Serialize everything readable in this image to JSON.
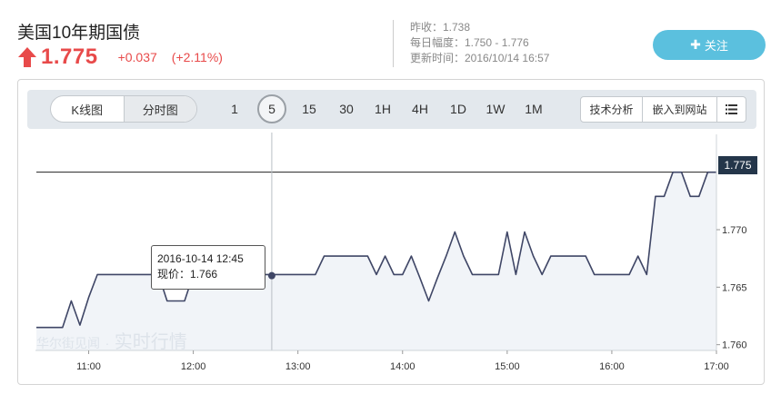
{
  "header": {
    "title": "美国10年期国债",
    "price": "1.775",
    "change": "+0.037",
    "change_pct": "(+2.11%)",
    "prev_close": "昨收：1.738",
    "day_range": "每日幅度：1.750 - 1.776",
    "updated": "更新时间：2016/10/14 16:57",
    "follow_label": "关注",
    "follow_icon": "plus-icon",
    "up_arrow_icon": "arrow-up-icon"
  },
  "toolbar": {
    "view_tabs": [
      "K线图",
      "分时图"
    ],
    "active_view": "分时图",
    "periods": [
      "1",
      "5",
      "15",
      "30",
      "1H",
      "4H",
      "1D",
      "1W",
      "1M"
    ],
    "active_period": "5",
    "tools": [
      "技术分析",
      "嵌入到网站"
    ],
    "menu_icon": "list-icon"
  },
  "watermark": {
    "brand": "华尔街见闻",
    "sep": "·",
    "tagline": "实时行情"
  },
  "tooltip": {
    "time": "2016-10-14 12:45",
    "price_label": "现价：",
    "price_value": "1.766"
  },
  "last_price_tag": "1.775",
  "colors": {
    "up": "#e84a4a",
    "line": "#3f4666",
    "area": "#f1f4f8",
    "follow_button": "#5bc0de",
    "price_tag": "#24364a"
  },
  "chart_data": {
    "type": "area",
    "xlabel": "",
    "ylabel": "",
    "x_ticks": [
      "11:00",
      "12:00",
      "13:00",
      "14:00",
      "15:00",
      "16:00",
      "17:00"
    ],
    "y_ticks": [
      "1.760",
      "1.765",
      "1.770",
      "1.775"
    ],
    "ylim": [
      1.7595,
      1.7775
    ],
    "grid": false,
    "reference_line": 1.775,
    "crosshair_time": "12:45",
    "series": [
      {
        "x": [
          "10:30",
          "10:35",
          "10:40",
          "10:45",
          "10:50",
          "10:55",
          "11:00",
          "11:05",
          "11:10",
          "11:15",
          "11:20",
          "11:25",
          "11:30",
          "11:35",
          "11:40",
          "11:45",
          "11:50",
          "11:55",
          "12:00",
          "12:05",
          "12:10",
          "12:15",
          "12:20",
          "12:25",
          "12:30",
          "12:35",
          "12:40",
          "12:45",
          "12:50",
          "12:55",
          "13:00",
          "13:05",
          "13:10",
          "13:15",
          "13:20",
          "13:25",
          "13:30",
          "13:35",
          "13:40",
          "13:45",
          "13:50",
          "13:55",
          "14:00",
          "14:05",
          "14:10",
          "14:15",
          "14:20",
          "14:25",
          "14:30",
          "14:35",
          "14:40",
          "14:45",
          "14:50",
          "14:55",
          "15:00",
          "15:05",
          "15:10",
          "15:15",
          "15:20",
          "15:25",
          "15:30",
          "15:35",
          "15:40",
          "15:45",
          "15:50",
          "15:55",
          "16:00",
          "16:05",
          "16:10",
          "16:15",
          "16:20",
          "16:25",
          "16:30",
          "16:35",
          "16:40",
          "16:45",
          "16:50",
          "16:55",
          "17:00"
        ],
        "values": [
          1.7615,
          1.7615,
          1.7615,
          1.7615,
          1.7638,
          1.7617,
          1.7641,
          1.7661,
          1.7661,
          1.7661,
          1.7661,
          1.7661,
          1.7661,
          1.7661,
          1.7661,
          1.7638,
          1.7638,
          1.7638,
          1.7661,
          1.7661,
          1.7661,
          1.7661,
          1.7661,
          1.7661,
          1.7661,
          1.7661,
          1.7661,
          1.7661,
          1.7661,
          1.7661,
          1.7661,
          1.7661,
          1.7661,
          1.7677,
          1.7677,
          1.7677,
          1.7677,
          1.7677,
          1.7677,
          1.7661,
          1.7677,
          1.7661,
          1.7661,
          1.7677,
          1.7658,
          1.7638,
          1.7658,
          1.7677,
          1.7698,
          1.7677,
          1.7661,
          1.7661,
          1.7661,
          1.7661,
          1.7698,
          1.7661,
          1.7698,
          1.7677,
          1.7661,
          1.7677,
          1.7677,
          1.7677,
          1.7677,
          1.7677,
          1.7661,
          1.7661,
          1.7661,
          1.7661,
          1.7661,
          1.7677,
          1.7661,
          1.7729,
          1.7729,
          1.775,
          1.775,
          1.7729,
          1.7729,
          1.775,
          1.775
        ]
      }
    ]
  }
}
